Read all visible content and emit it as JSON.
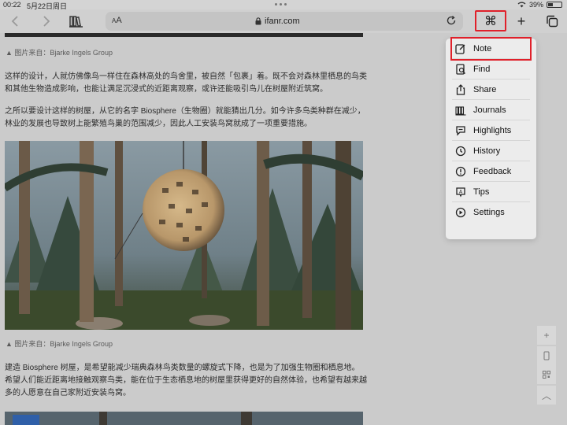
{
  "status": {
    "time": "00:22",
    "date": "5月22日周日",
    "battery": "39%"
  },
  "toolbar": {
    "aa_small": "A",
    "aa_large": "A",
    "url": "ifanr.com",
    "command_symbol": "⌘",
    "new_tab": "+"
  },
  "article": {
    "caption1": "▲ 图片来自：Bjarke Ingels Group",
    "para1": "这样的设计，人就仿佛像鸟一样住在森林高处的鸟舍里，被自然「包裹」着。既不会对森林里栖息的鸟类和其他生物造成影响，也能让满足沉浸式的近距离观察，或许还能吸引鸟儿在树屋附近筑窝。",
    "para2": "之所以要设计这样的树屋，从它的名字 Biosphere（生物圈）就能猜出几分。如今许多鸟类种群在减少，林业的发展也导致树上能繁殖鸟巢的范围减少，因此人工安装鸟窝就成了一项重要措施。",
    "caption2": "▲ 图片来自：Bjarke Ingels Group",
    "para3": "建造 Biosphere 树屋，是希望能减少瑞典森林鸟类数量的螺旋式下降，也是为了加强生物圈和栖息地。希望人们能近距离地接触观察鸟类，能在位于生态栖息地的树屋里获得更好的自然体验，也希望有越来越多的人愿意在自己家附近安装鸟窝。"
  },
  "menu": {
    "items": [
      {
        "label": "Note",
        "icon": "note-icon"
      },
      {
        "label": "Find",
        "icon": "find-icon"
      },
      {
        "label": "Share",
        "icon": "share-icon"
      },
      {
        "label": "Journals",
        "icon": "journals-icon"
      },
      {
        "label": "Highlights",
        "icon": "highlights-icon"
      },
      {
        "label": "History",
        "icon": "history-icon"
      },
      {
        "label": "Feedback",
        "icon": "feedback-icon"
      },
      {
        "label": "Tips",
        "icon": "tips-icon"
      },
      {
        "label": "Settings",
        "icon": "settings-icon"
      }
    ]
  },
  "side": {
    "plus": "+",
    "up": "︿"
  },
  "colors": {
    "highlight_border": "#e0202a"
  }
}
